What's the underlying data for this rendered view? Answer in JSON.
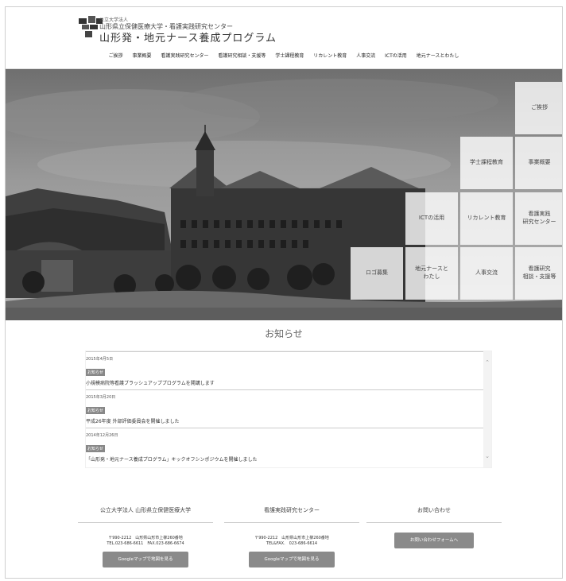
{
  "header": {
    "org_line1": "公立大学法人",
    "org_line2": "山形県立保健医療大学・看護実践研究センター",
    "program_title": "山形発・地元ナース養成プログラム"
  },
  "nav": [
    "ご挨拶",
    "事業概要",
    "看護実践研究センター",
    "看護研究相談・支援等",
    "学士課程教育",
    "リカレント教育",
    "人事交流",
    "ICTの活用",
    "地元ナースとわたし"
  ],
  "tiles": {
    "greeting": "ご挨拶",
    "bachelor": "学士課程教育",
    "overview": "事業概要",
    "ict": "ICTの活用",
    "recurrent": "リカレント教育",
    "center": "看護実践\n研究センター",
    "logo_call": "ロゴ募集",
    "local": "地元ナースと\nわたし",
    "exchange": "人事交流",
    "research": "看護研究\n相談・支援等"
  },
  "news": {
    "title": "お知らせ",
    "items": [
      {
        "date": "2015年4月5日",
        "badge": "お知らせ",
        "text": "小規模病院等看護ブラッシュアッププログラムを開講します"
      },
      {
        "date": "2015年3月20日",
        "badge": "お知らせ",
        "text": "平成26年度 外部評価委員会を開催しました"
      },
      {
        "date": "2014年12月26日",
        "badge": "お知らせ",
        "text": "「山形発・地元ナース養成プログラム」キックオフシンポジウムを開催しました"
      }
    ]
  },
  "footer": {
    "univ_heading": "公立大学法人 山形県立保健医療大学",
    "univ_addr1": "〒990-2212　山形県山形市上柳260番地",
    "univ_addr2": "TEL.023-686-6611　FAX.023-686-6674",
    "center_heading": "看護実践研究センター",
    "center_addr1": "〒990-2212　山形県山形市上柳260番地",
    "center_addr2": "TEL&FAX.　023-686-6614",
    "gmap_label": "Googleマップで地図を見る",
    "contact_heading": "お問い合わせ",
    "contact_btn": "お問い合わせフォームへ"
  },
  "colors": {
    "tile_bg": "#ffffff",
    "button_bg": "#8a8a8a",
    "badge_bg": "#888888"
  }
}
